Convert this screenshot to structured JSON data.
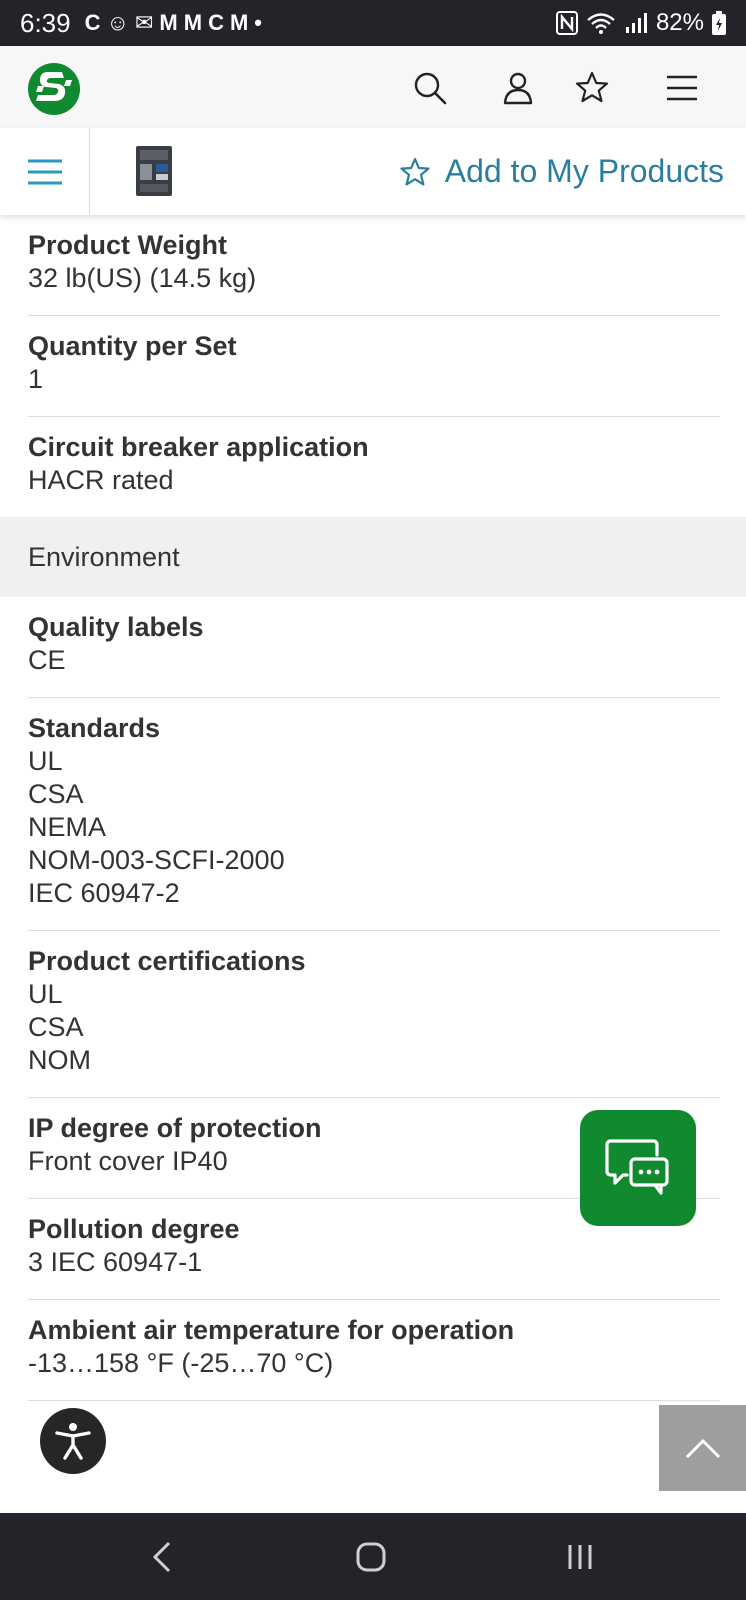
{
  "status_bar": {
    "time": "6:39",
    "left_icons": [
      "C",
      "☺",
      "✉",
      "M",
      "M",
      "C",
      "M",
      "•"
    ],
    "battery": "82%"
  },
  "header": {
    "logo_icon": "schneider-logo-icon",
    "icons": [
      "search-icon",
      "user-icon",
      "star-icon",
      "menu-icon"
    ]
  },
  "product_bar": {
    "add_label": "Add to My Products"
  },
  "specs_top": [
    {
      "label": "Product Weight",
      "values": [
        "32 lb(US) (14.5 kg)"
      ]
    },
    {
      "label": "Quantity per Set",
      "values": [
        "1"
      ]
    },
    {
      "label": "Circuit breaker application",
      "values": [
        "HACR rated"
      ]
    }
  ],
  "section": {
    "title": "Environment"
  },
  "specs_env": [
    {
      "label": "Quality labels",
      "values": [
        "CE"
      ]
    },
    {
      "label": "Standards",
      "values": [
        "UL",
        "CSA",
        "NEMA",
        "NOM-003-SCFI-2000",
        "IEC 60947-2"
      ]
    },
    {
      "label": "Product certifications",
      "values": [
        "UL",
        "CSA",
        "NOM"
      ]
    },
    {
      "label": "IP degree of protection",
      "values": [
        "Front cover IP40"
      ]
    },
    {
      "label": "Pollution degree",
      "values": [
        "3 IEC 60947-1"
      ]
    },
    {
      "label": "Ambient air temperature for operation",
      "values": [
        "-13…158 °F (-25…70 °C)"
      ]
    }
  ],
  "colors": {
    "brand_green": "#11892f",
    "link_blue": "#2a7ea0"
  }
}
